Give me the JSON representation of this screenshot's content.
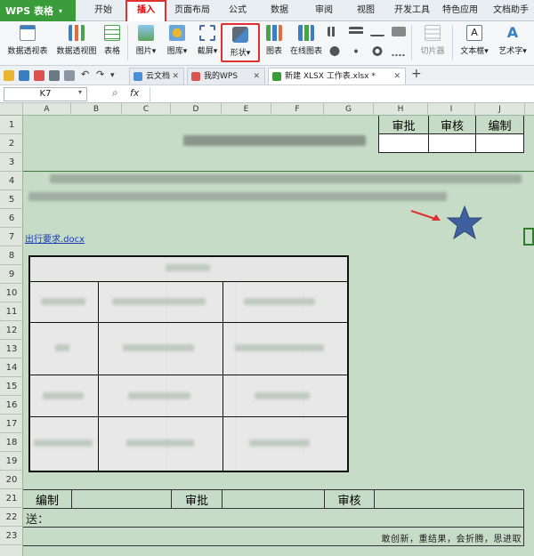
{
  "app": {
    "title": "WPS 表格"
  },
  "ribbon_tabs": [
    "开始",
    "插入",
    "页面布局",
    "公式",
    "数据",
    "审阅",
    "视图",
    "开发工具",
    "特色应用",
    "文档助手"
  ],
  "ribbon_tab_active": "插入",
  "toolbar": {
    "pivot_table": "数据透视表",
    "pivot_chart": "数据透视图",
    "table": "表格",
    "picture": "图片",
    "gallery": "图库",
    "screenshot": "截屏",
    "shapes": "形状",
    "chart": "图表",
    "online_chart": "在线图表",
    "slicer": "切片器",
    "textbox": "文本框",
    "wordart": "艺术字"
  },
  "doc_tabs": [
    "云文档",
    "我的WPS",
    "新建 XLSX 工作表.xlsx *"
  ],
  "formula_bar": {
    "cell_ref": "K7",
    "fx": "fx"
  },
  "columns": [
    "A",
    "B",
    "C",
    "D",
    "E",
    "F",
    "G",
    "H",
    "I",
    "J"
  ],
  "rows": [
    "1",
    "2",
    "3",
    "4",
    "5",
    "6",
    "7",
    "8",
    "9",
    "10",
    "11",
    "12",
    "13",
    "14",
    "15",
    "16",
    "17",
    "18",
    "19",
    "20",
    "21",
    "22",
    "23"
  ],
  "sheet": {
    "approval_headers": [
      "审批",
      "审核",
      "编制"
    ],
    "link_text": "出行要求.docx",
    "footer_labels": [
      "编制",
      "审批",
      "审核"
    ],
    "send_label": "送：",
    "slogan": "敢创新，重结果，会折腾，思进取"
  },
  "colors": {
    "highlight": "#e03131",
    "sheet_bg": "#c6dcc6",
    "star": "#3f5f9e",
    "app_green": "#3a9b3a"
  }
}
